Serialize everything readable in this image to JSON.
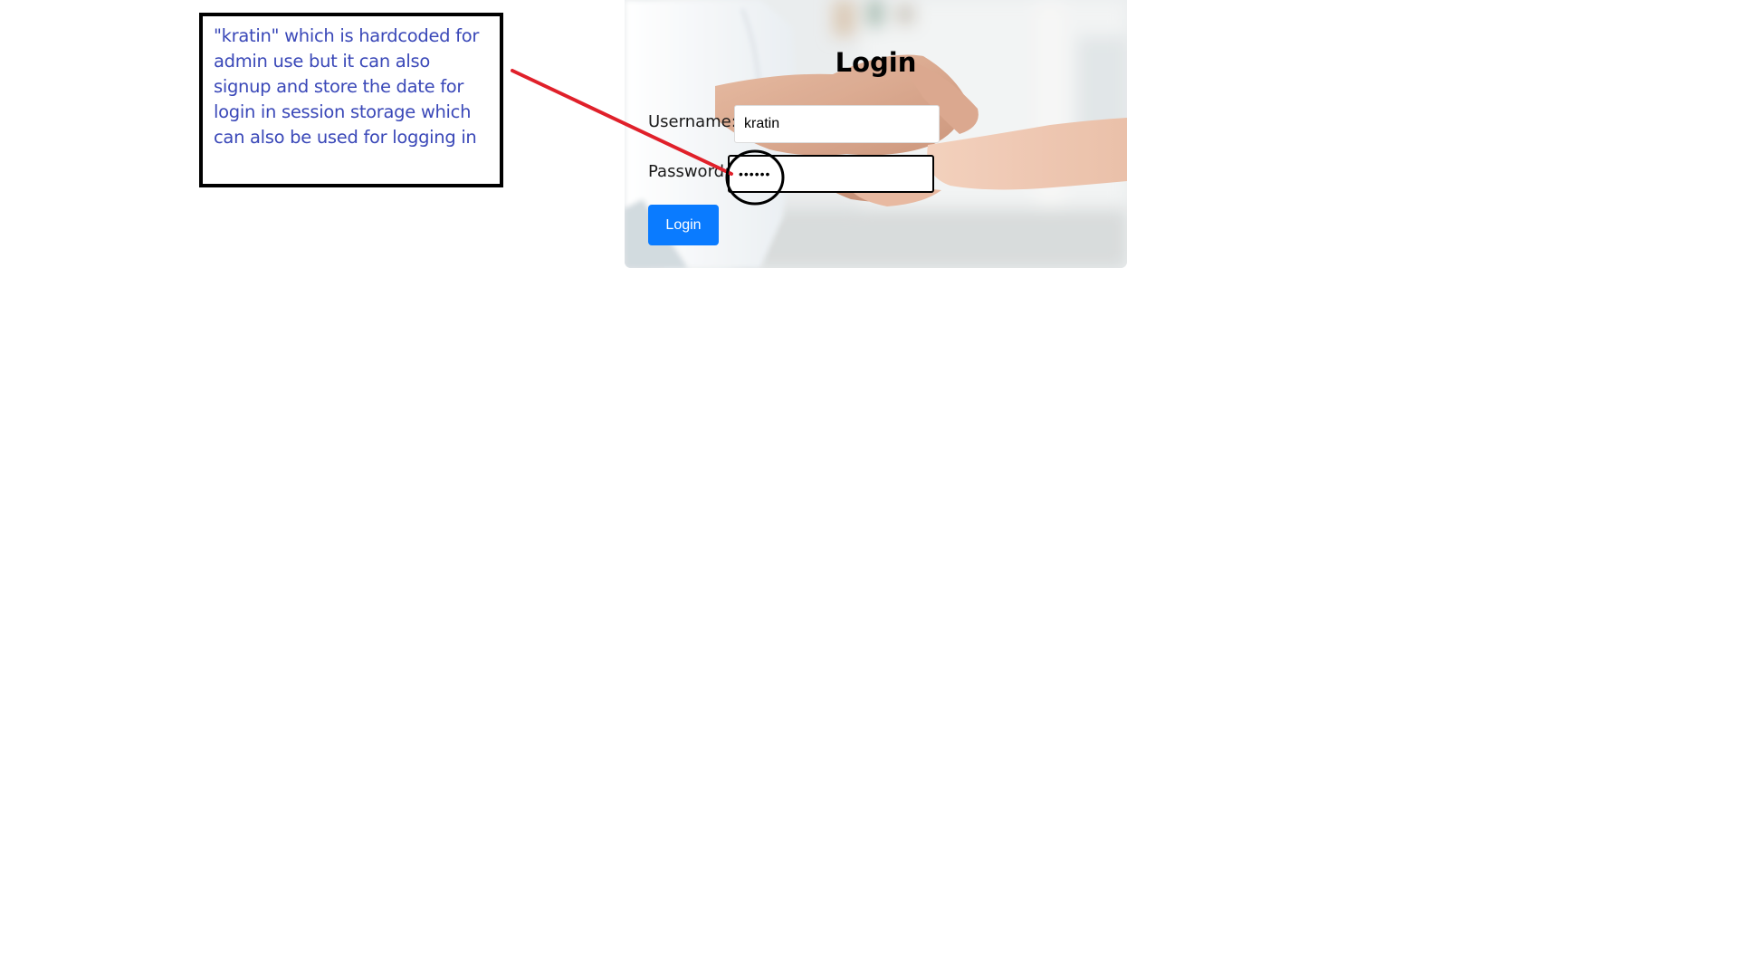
{
  "annotation": {
    "text": "\"kratin\" which is hardcoded for admin use but it can also signup and store the date for login in session storage which can also be used for logging in",
    "text_color": "#3a48b8",
    "arrow_color": "#e0202a"
  },
  "login": {
    "title": "Login",
    "username_label": "Username:",
    "username_value": "kratin",
    "password_label": "Password:",
    "password_value": "kratin",
    "button_label": "Login",
    "button_color": "#0a7bff"
  }
}
